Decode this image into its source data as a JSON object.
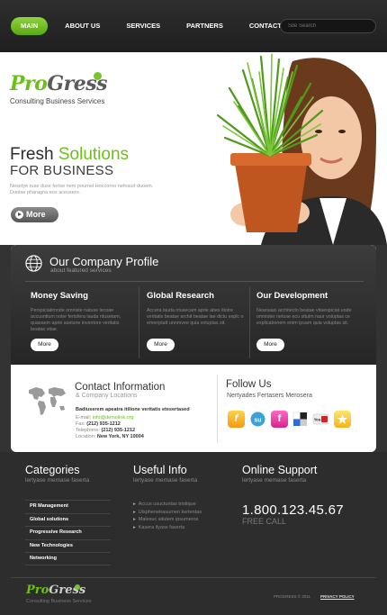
{
  "nav": {
    "items": [
      {
        "label": "MAIN",
        "active": true
      },
      {
        "label": "ABOUT US",
        "active": false
      },
      {
        "label": "SERVICES",
        "active": false
      },
      {
        "label": "PARTNERS",
        "active": false
      },
      {
        "label": "CONTACTS",
        "active": false
      }
    ],
    "search_placeholder": "Site Search"
  },
  "brand": {
    "logo_part1": "Pro",
    "logo_part2": "Gress",
    "tagline": "Consulting Business Services"
  },
  "hero": {
    "title_part1": "Fresh ",
    "title_part2": "Solutions",
    "subtitle": "FOR BUSINESS",
    "text": "Nesetye ruse duse fertse nem pournel Hoccorno nefosud duoem. Duolae pharagna eos aceusero.",
    "more_label": "More"
  },
  "profile": {
    "title": "Our Company Profile",
    "subtitle": "about featured services",
    "columns": [
      {
        "title": "Money Saving",
        "text": "Perspiciatimnde omniste natuse lecoae accusntium noler fertsfera lauda ntusetam, quaeaem aprie aseiune inventore veritatis beatae vitae.",
        "button": "More"
      },
      {
        "title": "Global Research",
        "text": "Accera lauda ntusecam aprie abes itiotre veritatis beatae archit beatae lae dictu explc o emenptatt unnmvee quia voluptas sit.",
        "button": "More"
      },
      {
        "title": "Our Development",
        "text": "Neanuasi architecto beatae vitaespiciat unde omnioter netuse ecu sttulm naur voluptas ce explicabonem enim ipsam quia voluptas sit.",
        "button": "More"
      }
    ]
  },
  "contact": {
    "title": "Contact Information",
    "subtitle": "& Company Locations",
    "headline": "Badiuserem apeatra itilione veritatis etesertased",
    "email_label": "E-mail:",
    "email": "info@demolink.org",
    "fax_label": "Fax:",
    "fax": "(212) 935-1212",
    "phone_label": "Telephone:",
    "phone": "(212) 935-1212",
    "location_label": "Location:",
    "location": "New York, NY 10004"
  },
  "follow": {
    "title": "Follow Us",
    "subtitle": "Nertyades Fertasers Merosera",
    "icons": [
      "facebook-style-icon",
      "stumbleupon-icon",
      "facebook-icon",
      "delicious-icon",
      "youtube-icon",
      "favorites-star-icon"
    ]
  },
  "footer": {
    "categories": {
      "title": "Categories",
      "subtitle": "lertyase memase faserta",
      "items": [
        "PR Management",
        "Global solutions",
        "Progressive Research",
        "New Technologies",
        "Networking"
      ]
    },
    "useful": {
      "title": "Useful Info",
      "subtitle": "lertyase memase faserta",
      "items": [
        "Accus usuctuntas tristique",
        "Ulsphenetrasumen kertentas",
        "Malesuc situtem ipsumeros",
        "Kasera ilyase faserta"
      ]
    },
    "support": {
      "title": "Online Support",
      "subtitle": "lertyase memase faserta",
      "phone": "1.800.123.45.67",
      "free": "FREE CALL"
    },
    "logo_part1": "Pro",
    "logo_part2": "Gress",
    "tagline": "Consulting Business Services",
    "copyright": "PROGRESS © 2011",
    "policy": "PRIVACY POLICY"
  },
  "colors": {
    "accent_green": "#6cbf1c",
    "dark": "#2d2d2d"
  }
}
